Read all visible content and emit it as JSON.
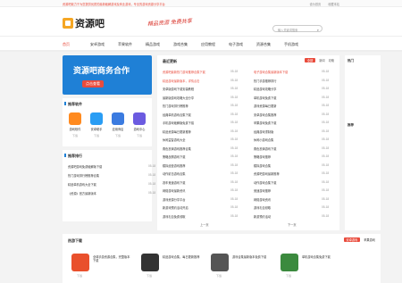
{
  "topbar": {
    "notice": "资源吧致力于为您提供优质的最新破解游戏及商业游戏，专业的游戏资源分享平台",
    "links": [
      "设为首页",
      "收藏本站"
    ]
  },
  "header": {
    "logo_text": "资源吧",
    "slogan": "精品资源  免费共享",
    "search_placeholder": "输入关键词搜索"
  },
  "nav": {
    "items": [
      "首页",
      "安卓游戏",
      "苹果软件",
      "精品游戏",
      "游戏合集",
      "应用教程",
      "电子游戏",
      "资源合集",
      "手机游戏"
    ]
  },
  "banner": {
    "title": "资源吧商务合作",
    "button": "点击查看"
  },
  "apps": {
    "title": "推荐软件",
    "items": [
      {
        "name": "游戏软件",
        "action": "下载",
        "color": "#ff8a1f"
      },
      {
        "name": "安卓助手",
        "action": "下载",
        "color": "#2a9df4"
      },
      {
        "name": "应用商店",
        "action": "下载",
        "color": "#3b7be0"
      },
      {
        "name": "游戏中心",
        "action": "下载",
        "color": "#6b5be0"
      }
    ]
  },
  "ranking": {
    "title": "推荐排行",
    "items": [
      {
        "title": "资源吧游戏免费破解版下载",
        "date": "05-18"
      },
      {
        "title": "热门游戏排行榜推荐合集",
        "date": "05-18"
      },
      {
        "title": "精品单机游戏大全下载",
        "date": "05-18"
      },
      {
        "title": "《资源》官方最新版本",
        "date": "05-18"
      }
    ]
  },
  "news": {
    "title": "最近更新",
    "tabs": [
      "全部",
      "新闻",
      "攻略"
    ],
    "left": [
      {
        "title": "资源吧最新热门游戏推荐合集下载",
        "date": "05-18",
        "hot": true
      },
      {
        "title": "精品游戏最新版本，详情点击",
        "date": "05-18",
        "hot": true
      },
      {
        "title": "安卓版游戏下载安装教程",
        "date": "05-18",
        "hot": false
      },
      {
        "title": "最新版游戏攻略大全分享",
        "date": "05-18",
        "hot": false
      },
      {
        "title": "热门游戏排行榜推荐",
        "date": "05-18",
        "hot": false
      },
      {
        "title": "经典单机游戏合集下载",
        "date": "05-18",
        "hot": false
      },
      {
        "title": "手机游戏破解版免费下载",
        "date": "05-18",
        "hot": false
      },
      {
        "title": "精品资源每日更新推荐",
        "date": "05-18",
        "hot": false
      },
      {
        "title": "休闲益智游戏大全",
        "date": "05-18",
        "hot": false
      },
      {
        "title": "角色扮演游戏推荐合集",
        "date": "05-18",
        "hot": false
      },
      {
        "title": "策略战棋游戏下载",
        "date": "05-18",
        "hot": false
      },
      {
        "title": "模拟经营游戏推荐",
        "date": "05-18",
        "hot": false
      },
      {
        "title": "动作射击游戏合集",
        "date": "05-18",
        "hot": false
      },
      {
        "title": "赛车竞速游戏下载",
        "date": "05-18",
        "hot": false
      },
      {
        "title": "网络游戏最新资讯",
        "date": "05-18",
        "hot": false
      },
      {
        "title": "游戏资源分享平台",
        "date": "05-18",
        "hot": false
      },
      {
        "title": "新游戏预约活动开启",
        "date": "05-18",
        "hot": false
      },
      {
        "title": "游戏礼包免费领取",
        "date": "05-18",
        "hot": false
      }
    ],
    "right": [
      {
        "title": "电子游戏合集最新版本下载",
        "date": "05-18",
        "hot": true
      },
      {
        "title": "热门手游推荐排行",
        "date": "05-18",
        "hot": false
      },
      {
        "title": "精品游戏攻略分享",
        "date": "05-18",
        "hot": false
      },
      {
        "title": "单机游戏免费下载",
        "date": "05-18",
        "hot": false
      },
      {
        "title": "游戏资源每日更新",
        "date": "05-18",
        "hot": false
      },
      {
        "title": "安卓游戏合集推荐",
        "date": "05-18",
        "hot": false
      },
      {
        "title": "苹果游戏免费下载",
        "date": "05-18",
        "hot": false
      },
      {
        "title": "经典游戏重制版",
        "date": "05-18",
        "hot": false
      },
      {
        "title": "休闲小游戏合集",
        "date": "05-18",
        "hot": false
      },
      {
        "title": "角色扮演游戏下载",
        "date": "05-18",
        "hot": false
      },
      {
        "title": "策略游戏推荐",
        "date": "05-18",
        "hot": false
      },
      {
        "title": "模拟游戏合集",
        "date": "05-18",
        "hot": false
      },
      {
        "title": "资源吧游戏最新推荐",
        "date": "05-18",
        "hot": false
      },
      {
        "title": "动作游戏合集下载",
        "date": "05-18",
        "hot": false
      },
      {
        "title": "竞速游戏推荐",
        "date": "05-18",
        "hot": false
      },
      {
        "title": "网络游戏资讯",
        "date": "05-18",
        "hot": false
      },
      {
        "title": "游戏礼包领取",
        "date": "05-18",
        "hot": false
      },
      {
        "title": "新游预约活动",
        "date": "05-18",
        "hot": false
      }
    ],
    "prev": "上一页",
    "next": "下一页"
  },
  "side": {
    "title1": "热门",
    "title2": "推荐"
  },
  "bottom": {
    "title": "热游下载",
    "tabs": [
      "安卓游戏",
      "苹果游戏"
    ],
    "games": [
      {
        "name": "全球手游资源合集，完整版本下载",
        "action": "下载",
        "color": "#e9502c"
      },
      {
        "name": "精品游戏合集，每日更新推荐",
        "action": "下载",
        "color": "#333333"
      },
      {
        "name": "游戏合集最新版本免费下载",
        "action": "下载",
        "color": "#555555"
      },
      {
        "name": "单机游戏合集免费下载",
        "action": "下载",
        "color": "#3b8a3e"
      }
    ]
  }
}
